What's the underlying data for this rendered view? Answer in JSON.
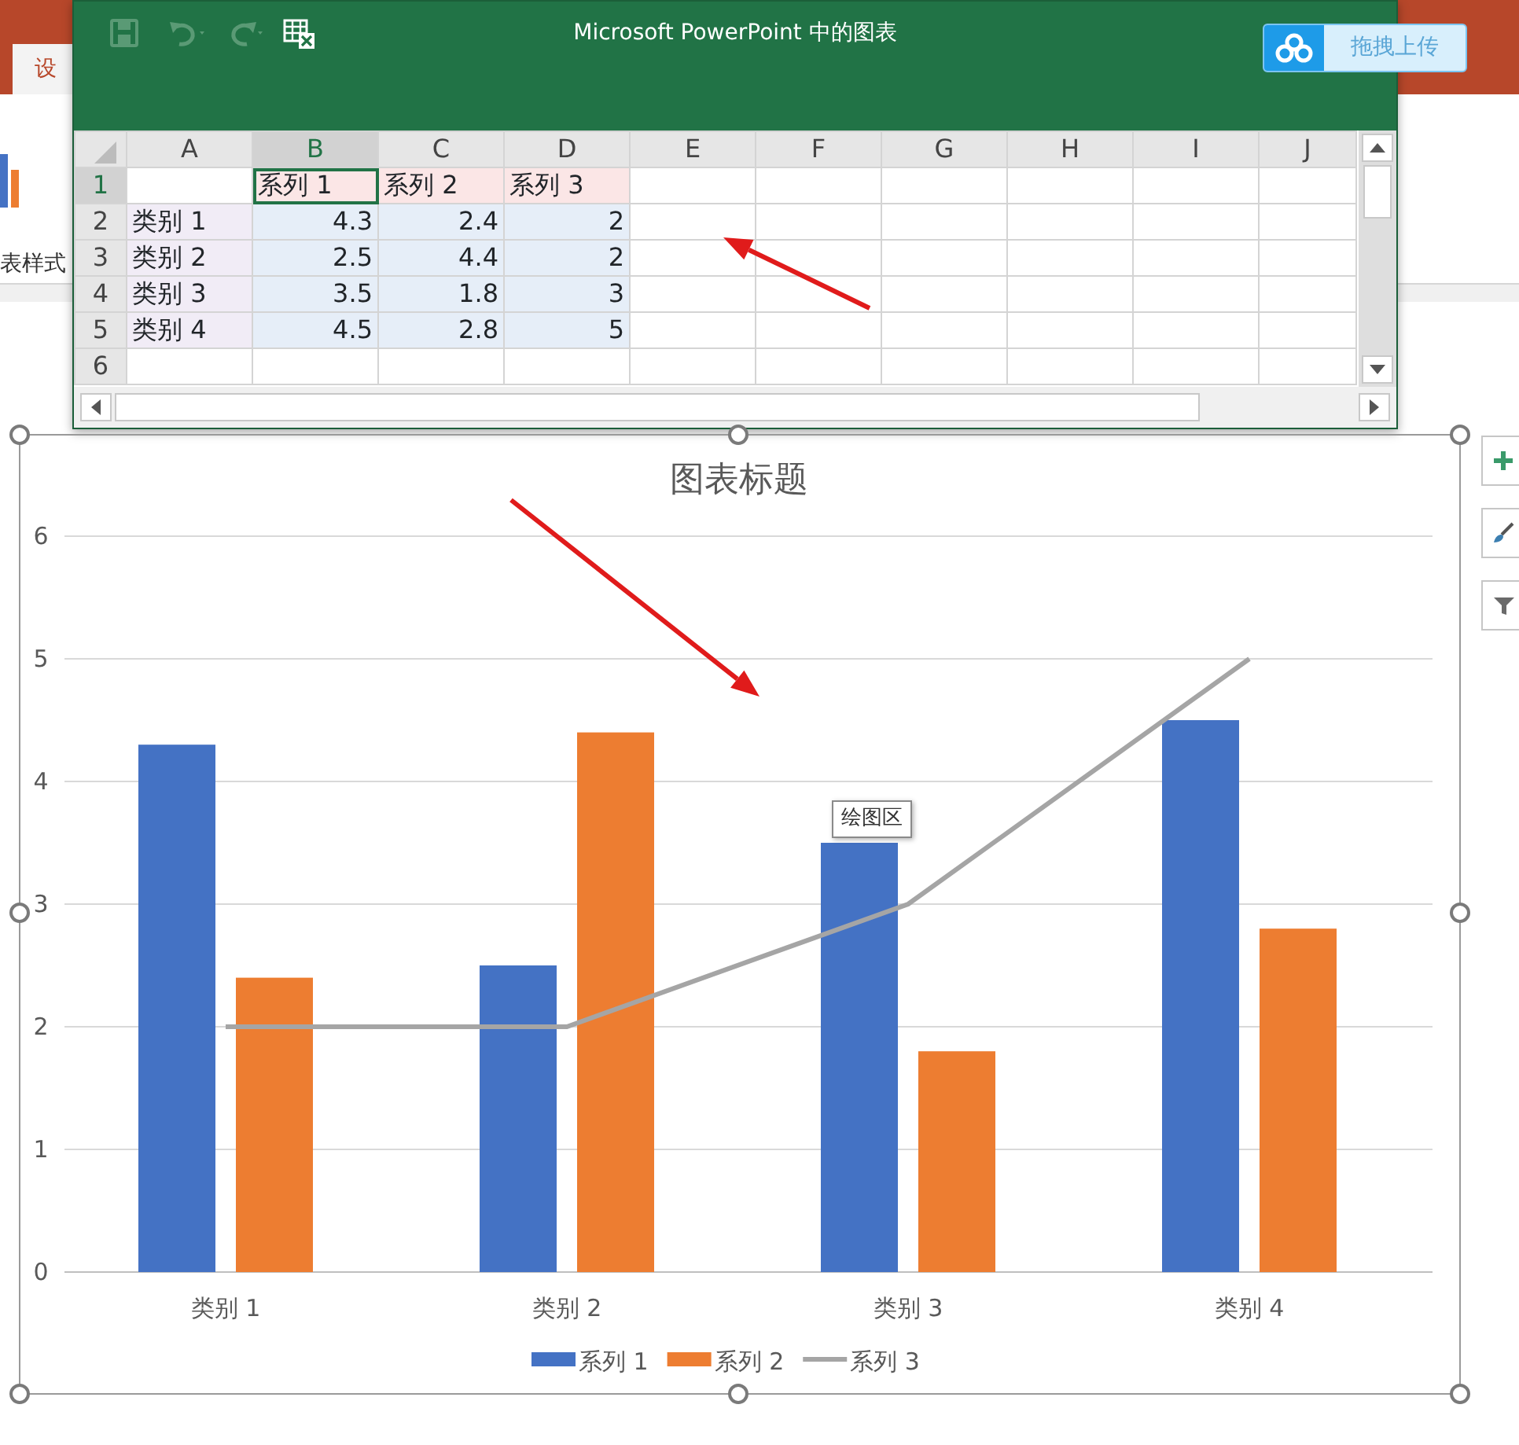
{
  "powerpoint": {
    "tab": "设",
    "ribbon_label": "表样式"
  },
  "excel_window": {
    "title": "Microsoft PowerPoint 中的图表",
    "toolbar": [
      {
        "kind": "save",
        "disabled": true
      },
      {
        "kind": "undo",
        "disabled": true
      },
      {
        "kind": "redo",
        "disabled": true
      },
      {
        "kind": "edit-in-excel",
        "disabled": false
      }
    ],
    "columns": [
      {
        "label": "A",
        "selected": false
      },
      {
        "label": "B",
        "selected": true
      },
      {
        "label": "C",
        "selected": false
      },
      {
        "label": "D",
        "selected": false
      },
      {
        "label": "E",
        "selected": false
      },
      {
        "label": "F",
        "selected": false
      },
      {
        "label": "G",
        "selected": false
      },
      {
        "label": "H",
        "selected": false
      },
      {
        "label": "I",
        "selected": false
      },
      {
        "label": "J",
        "selected": false
      }
    ],
    "rows": [
      {
        "number": "1",
        "selected": true,
        "kind": "series",
        "cells": [
          "系列 1",
          "系列 2",
          "系列 3"
        ]
      },
      {
        "number": "2",
        "selected": false,
        "kind": "category",
        "category": "类别 1",
        "cells": [
          "4.3",
          "2.4",
          "2"
        ]
      },
      {
        "number": "3",
        "selected": false,
        "kind": "category",
        "category": "类别 2",
        "cells": [
          "2.5",
          "4.4",
          "2"
        ]
      },
      {
        "number": "4",
        "selected": false,
        "kind": "category",
        "category": "类别 3",
        "cells": [
          "3.5",
          "1.8",
          "3"
        ]
      },
      {
        "number": "5",
        "selected": false,
        "kind": "category",
        "category": "类别 4",
        "cells": [
          "4.5",
          "2.8",
          "5"
        ]
      },
      {
        "number": "6",
        "selected": false,
        "kind": "empty"
      }
    ]
  },
  "upload_button": {
    "label": "拖拽上传"
  },
  "chart": {
    "tooltip": "绘图区",
    "chart_data": {
      "type": "bar",
      "title": "图表标题",
      "categories": [
        "类别 1",
        "类别 2",
        "类别 3",
        "类别 4"
      ],
      "ylim": [
        0,
        6
      ],
      "grid": true,
      "legend": true,
      "yticks": [
        {
          "value": 0,
          "label": "0"
        },
        {
          "value": 1,
          "label": "1"
        },
        {
          "value": 2,
          "label": "2"
        },
        {
          "value": 3,
          "label": "3"
        },
        {
          "value": 4,
          "label": "4"
        },
        {
          "value": 5,
          "label": "5"
        },
        {
          "value": 6,
          "label": "6"
        }
      ],
      "series": [
        {
          "name": "系列 1",
          "color": "#4472c4",
          "values": [
            4.3,
            2.5,
            3.5,
            4.5
          ]
        },
        {
          "name": "系列 2",
          "color": "#ed7d31",
          "values": [
            2.4,
            4.4,
            1.8,
            2.8
          ]
        },
        {
          "name": "系列 3",
          "color": "#a5a5a5",
          "type": "line",
          "values": [
            2,
            2,
            3,
            5
          ]
        }
      ]
    }
  }
}
